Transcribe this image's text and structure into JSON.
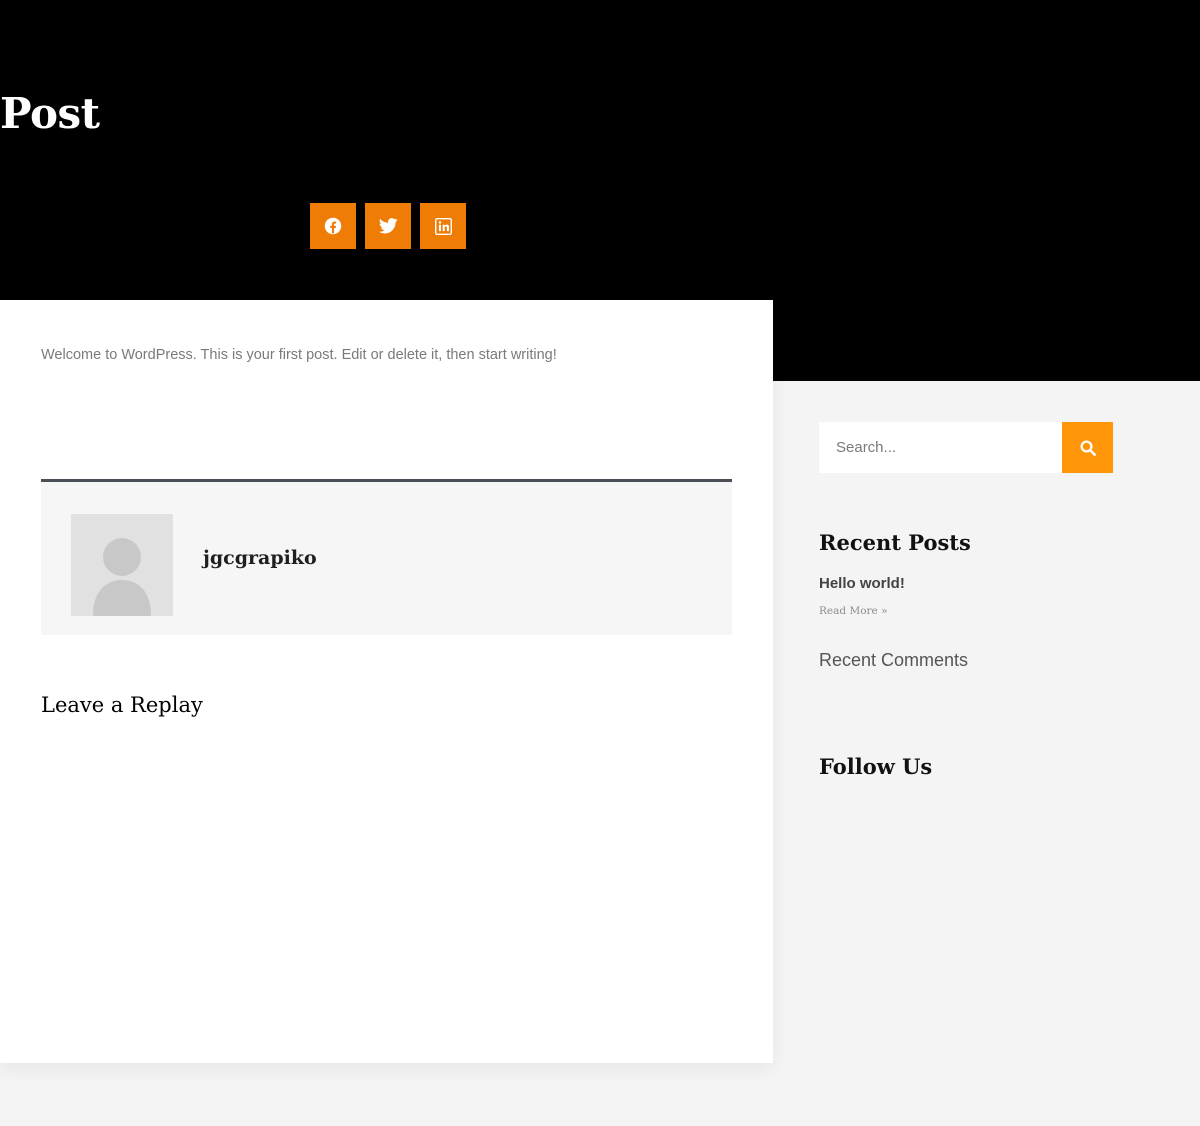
{
  "header": {
    "title": "Post"
  },
  "share": {
    "facebook_icon": "facebook-icon",
    "twitter_icon": "twitter-icon",
    "linkedin_icon": "linkedin-icon",
    "accent_color": "#ee7c05"
  },
  "post": {
    "content": "Welcome to WordPress. This is your first post. Edit or delete it, then start writing!"
  },
  "author": {
    "name": "jgcgrapiko",
    "avatar_icon": "default-avatar-icon"
  },
  "comments": {
    "heading": "Leave a Replay"
  },
  "sidebar": {
    "search": {
      "placeholder": "Search...",
      "value": "",
      "button_icon": "search-icon",
      "button_color": "#ff960a"
    },
    "recent_posts": {
      "heading": "Recent Posts",
      "items": [
        {
          "title": "Hello world!",
          "read_more": "Read More »"
        }
      ]
    },
    "recent_comments": {
      "heading": "Recent Comments"
    },
    "follow": {
      "heading": "Follow Us"
    }
  }
}
